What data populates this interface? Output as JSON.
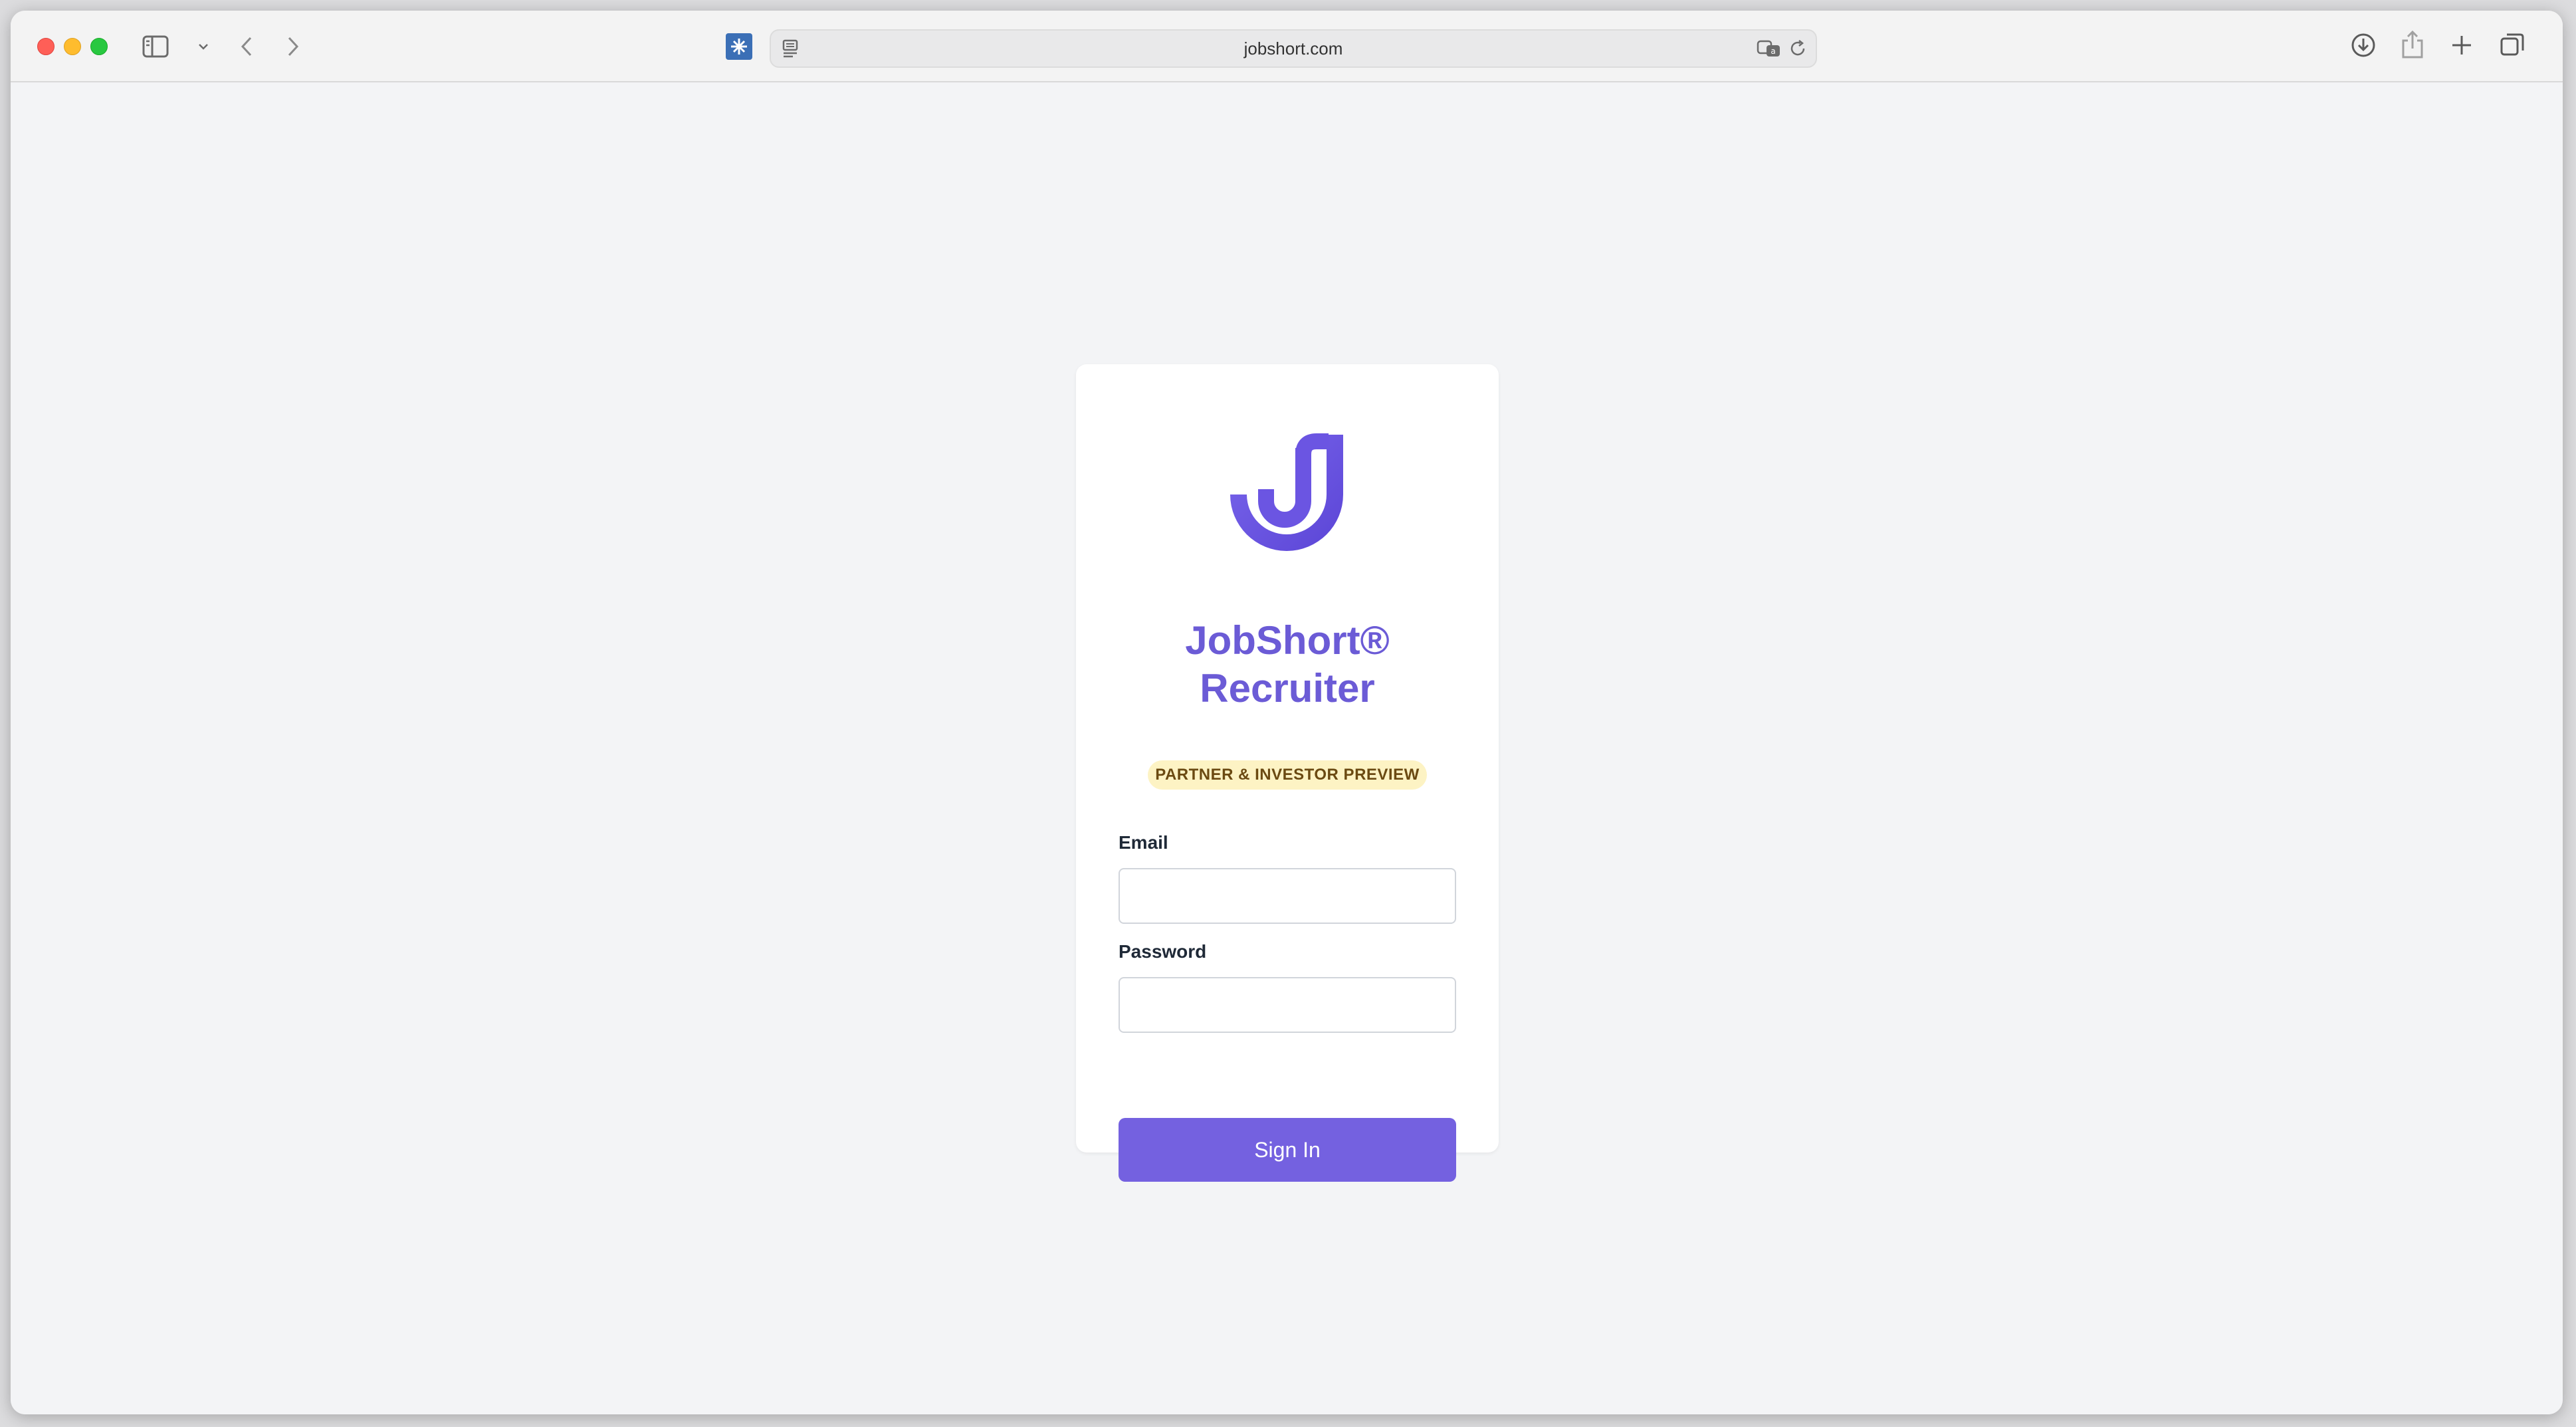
{
  "browser": {
    "url": "jobshort.com"
  },
  "app": {
    "title_line1": "JobShort®",
    "title_line2": "Recruiter",
    "badge": "PARTNER & INVESTOR PREVIEW",
    "brand_color": "#6b5bd6",
    "button_color": "#7461e0"
  },
  "form": {
    "email_label": "Email",
    "email_value": "",
    "password_label": "Password",
    "password_value": "",
    "submit_label": "Sign In"
  },
  "icons": {
    "logo": "jobshort-logo-icon",
    "sidebar": "sidebar-icon",
    "back": "chevron-left-icon",
    "forward": "chevron-right-icon",
    "extension": "extension-icon",
    "reader": "reader-icon",
    "translate": "translate-icon",
    "reload": "reload-icon",
    "download": "download-icon",
    "share": "share-icon",
    "new_tab": "plus-icon",
    "tabs": "tabs-overview-icon"
  }
}
